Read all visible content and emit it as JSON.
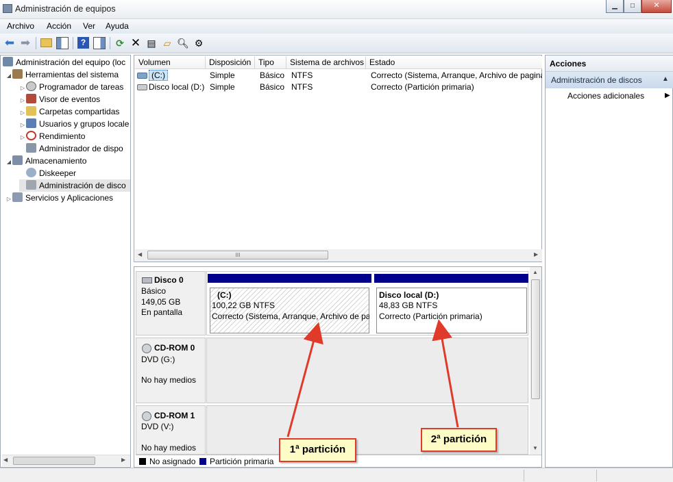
{
  "window": {
    "title": "Administración de equipos",
    "minimize": "▁",
    "maximize": "□",
    "close": "✕"
  },
  "menu": [
    {
      "label": "Archivo"
    },
    {
      "label": "Acción"
    },
    {
      "label": "Ver"
    },
    {
      "label": "Ayuda"
    }
  ],
  "toolbar_icons": [
    "back-arrow-icon",
    "forward-arrow-icon",
    "up-folder-icon",
    "show-hide-tree-icon",
    "help-icon",
    "show-hide-actions-icon",
    "refresh-icon",
    "delete-icon",
    "properties-icon",
    "open-folder-icon",
    "search-icon",
    "settings-icon"
  ],
  "tree": [
    {
      "label": "Administración del equipo (loc",
      "level": 0,
      "expander": ""
    },
    {
      "label": "Herramientas del sistema",
      "level": 1,
      "expander": "◢"
    },
    {
      "label": "Programador de tareas",
      "level": 2,
      "expander": "▷"
    },
    {
      "label": "Visor de eventos",
      "level": 2,
      "expander": "▷"
    },
    {
      "label": "Carpetas compartidas",
      "level": 2,
      "expander": "▷"
    },
    {
      "label": "Usuarios y grupos locale",
      "level": 2,
      "expander": "▷"
    },
    {
      "label": "Rendimiento",
      "level": 2,
      "expander": "▷"
    },
    {
      "label": "Administrador de dispo",
      "level": 2,
      "expander": ""
    },
    {
      "label": "Almacenamiento",
      "level": 1,
      "expander": "◢"
    },
    {
      "label": "Diskeeper",
      "level": 2,
      "expander": ""
    },
    {
      "label": "Administración de disco",
      "level": 2,
      "expander": ""
    },
    {
      "label": "Servicios y Aplicaciones",
      "level": 1,
      "expander": "▷"
    }
  ],
  "volume_table": {
    "columns": [
      "Volumen",
      "Disposición",
      "Tipo",
      "Sistema de archivos",
      "Estado"
    ],
    "rows": [
      [
        "(C:)",
        "Simple",
        "Básico",
        "NTFS",
        "Correcto (Sistema, Arranque, Archivo de pagina"
      ],
      [
        "Disco local (D:)",
        "Simple",
        "Básico",
        "NTFS",
        "Correcto (Partición primaria)"
      ]
    ],
    "hscroll_grip": "III"
  },
  "disks": [
    {
      "name": "Disco 0",
      "type": "Básico",
      "size": "149,05 GB",
      "status": "En pantalla",
      "partitions": [
        {
          "name": "(C:)",
          "size": "100,22 GB NTFS",
          "status": "Correcto (Sistema, Arranque, Archivo de pa"
        },
        {
          "name": "Disco local  (D:)",
          "size": "48,83 GB NTFS",
          "status": "Correcto (Partición primaria)"
        }
      ]
    },
    {
      "name": "CD-ROM 0",
      "type": "DVD (G:)",
      "status": "No hay medios"
    },
    {
      "name": "CD-ROM 1",
      "type": "DVD (V:)",
      "status": "No hay medios"
    }
  ],
  "legend": [
    {
      "label": "No asignado",
      "color": "#000000"
    },
    {
      "label": "Partición primaria",
      "color": "#00008b"
    }
  ],
  "actions": {
    "title": "Acciones",
    "section": "Administración de discos",
    "more": "Acciones adicionales"
  },
  "callouts": [
    {
      "label": "1ª partición"
    },
    {
      "label": "2ª partición"
    }
  ],
  "colors": {
    "partition_header": "#00008b",
    "callout_border": "#e03a2a",
    "callout_fill": "#fdfbc6",
    "selection": "#cce4f7"
  }
}
